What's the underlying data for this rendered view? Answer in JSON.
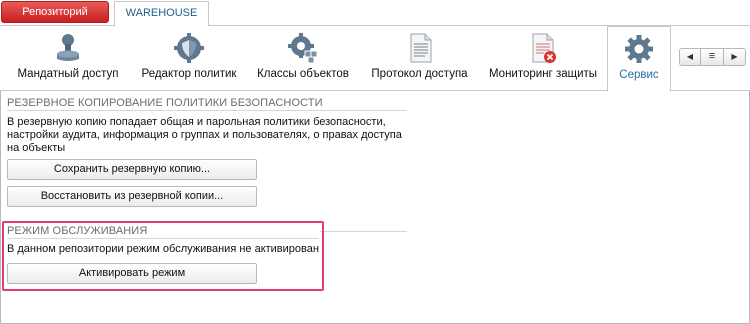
{
  "topbar": {
    "repo_button": "Репозиторий",
    "active_tab": "WAREHOUSE"
  },
  "ribbon": {
    "tabs": [
      {
        "label": "Мандатный доступ",
        "icon": "stamp-icon"
      },
      {
        "label": "Редактор политик",
        "icon": "shield-gear-icon"
      },
      {
        "label": "Классы объектов",
        "icon": "cubes-gear-icon"
      },
      {
        "label": "Протокол доступа",
        "icon": "document-icon"
      },
      {
        "label": "Мониторинг защиты",
        "icon": "document-error-icon"
      },
      {
        "label": "Сервис",
        "icon": "gear-icon",
        "active": true
      }
    ],
    "nav_icons": [
      "chevron-left-icon",
      "menu-icon",
      "chevron-right-icon"
    ]
  },
  "backup": {
    "title": "РЕЗЕРВНОЕ КОПИРОВАНИЕ ПОЛИТИКИ БЕЗОПАСНОСТИ",
    "description_lines": [
      "В резервную копию попадает общая и парольная политики безопасности,",
      "настройки аудита, информация о группах и пользователях, о правах доступа",
      "на объекты"
    ],
    "save_button": "Сохранить резервную копию...",
    "restore_button": "Восстановить из резервной копии..."
  },
  "maintenance": {
    "title": "РЕЖИМ ОБСЛУЖИВАНИЯ",
    "status_text": "В данном репозитории режим обслуживания не активирован",
    "activate_button": "Активировать режим",
    "highlight_color": "#e03c7c"
  }
}
